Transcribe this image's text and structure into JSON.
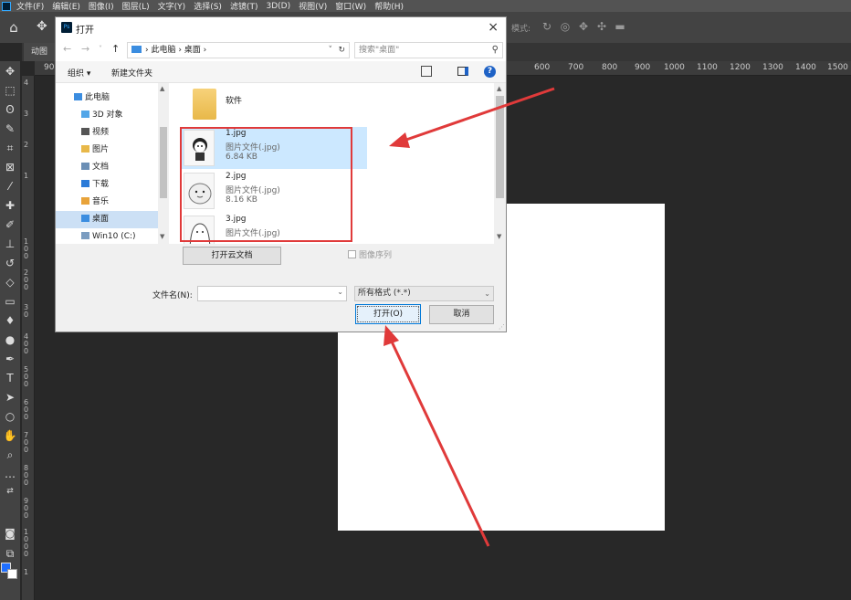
{
  "menubar": {
    "items": [
      "文件(F)",
      "编辑(E)",
      "图像(I)",
      "图层(L)",
      "文字(Y)",
      "选择(S)",
      "滤镜(T)",
      "3D(D)",
      "视图(V)",
      "窗口(W)",
      "帮助(H)"
    ]
  },
  "optionsbar": {
    "mode_label": "模式:",
    "icons": [
      "home-icon",
      "move-icon",
      "3d-orbit-icon",
      "3d-roll-icon",
      "3d-pan-icon",
      "3d-slide-icon",
      "3d-scale-icon"
    ]
  },
  "document": {
    "tab_label": "动图"
  },
  "ruler": {
    "h_ticks": [
      "90",
      "600",
      "700",
      "800",
      "900",
      "1000",
      "1100",
      "1200",
      "1300",
      "1400",
      "1500"
    ],
    "v_ticks": [
      "4",
      "3",
      "2",
      "1",
      "1 0 0",
      "2 0 0",
      "3 0",
      "4 0 0",
      "5 0 0",
      "6 0 0",
      "7 0 0",
      "8 0 0",
      "9 0 0",
      "1 0 0 0",
      "1"
    ]
  },
  "colors": {
    "foreground": "#1f6fff",
    "background": "#ffffff",
    "annotation": "#e03a3a"
  },
  "dialog": {
    "title": "打开",
    "close_glyph": "×",
    "nav": {
      "back": "←",
      "forward": "→",
      "recent": "˅",
      "up": "↑"
    },
    "address": {
      "path": "› 此电脑 › 桌面 ›",
      "dropdown": "˅",
      "refresh": "↻"
    },
    "search_placeholder": "搜索\"桌面\"",
    "commands": {
      "organize": "组织 ▾",
      "new_folder": "新建文件夹"
    },
    "nav_pane": [
      {
        "label": "此电脑",
        "icon": "computer-icon",
        "color": "#3b8de0"
      },
      {
        "label": "3D 对象",
        "icon": "3d-objects-icon",
        "color": "#52a6e8"
      },
      {
        "label": "视频",
        "icon": "video-icon",
        "color": "#555555"
      },
      {
        "label": "图片",
        "icon": "pictures-icon",
        "color": "#e8b849"
      },
      {
        "label": "文档",
        "icon": "documents-icon",
        "color": "#6b8fb5"
      },
      {
        "label": "下载",
        "icon": "downloads-icon",
        "color": "#2b7bd8"
      },
      {
        "label": "音乐",
        "icon": "music-icon",
        "color": "#e8a33a"
      },
      {
        "label": "桌面",
        "icon": "desktop-icon",
        "color": "#3b8de0"
      },
      {
        "label": "Win10 (C:)",
        "icon": "drive-icon",
        "color": "#7a9cc0"
      }
    ],
    "files": {
      "folder": {
        "name": "软件"
      },
      "images": [
        {
          "name": "1.jpg",
          "type": "图片文件(.jpg)",
          "size": "6.84 KB"
        },
        {
          "name": "2.jpg",
          "type": "图片文件(.jpg)",
          "size": "8.16 KB"
        },
        {
          "name": "3.jpg",
          "type": "图片文件(.jpg)",
          "size": ""
        }
      ]
    },
    "cloud_button": "打开云文档",
    "image_sequence": "图像序列",
    "filename_label": "文件名(N):",
    "filename_value": "",
    "filter_value": "所有格式 (*.*)",
    "open_button": "打开(O)",
    "cancel_button": "取消"
  }
}
